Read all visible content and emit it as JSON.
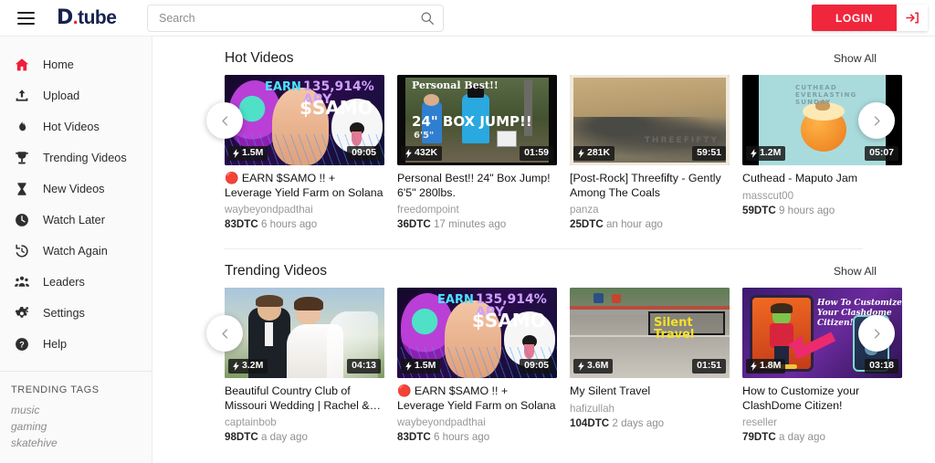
{
  "brand": {
    "logo_d": "D",
    "logo_dot": ".",
    "logo_rest": "tube"
  },
  "search": {
    "placeholder": "Search",
    "value": "",
    "icon": "search-icon"
  },
  "auth": {
    "login_label": "LOGIN",
    "signin_icon": "sign-in-icon"
  },
  "colors": {
    "accent_red": "#f0263c",
    "brand_navy": "#17224d",
    "sidebar_bg": "#fafafa"
  },
  "sidebar": {
    "items": [
      {
        "label": "Home",
        "icon": "home-icon",
        "active": true
      },
      {
        "label": "Upload",
        "icon": "upload-icon",
        "active": false
      },
      {
        "label": "Hot Videos",
        "icon": "flame-icon",
        "active": false
      },
      {
        "label": "Trending Videos",
        "icon": "trophy-icon",
        "active": false
      },
      {
        "label": "New Videos",
        "icon": "hourglass-icon",
        "active": false
      },
      {
        "label": "Watch Later",
        "icon": "clock-icon",
        "active": false
      },
      {
        "label": "Watch Again",
        "icon": "history-icon",
        "active": false
      },
      {
        "label": "Leaders",
        "icon": "people-icon",
        "active": false
      },
      {
        "label": "Settings",
        "icon": "gear-icon",
        "active": false
      },
      {
        "label": "Help",
        "icon": "help-icon",
        "active": false
      }
    ],
    "tags_title": "TRENDING TAGS",
    "tags": [
      "music",
      "gaming",
      "skatehive"
    ]
  },
  "sections": [
    {
      "title": "Hot Videos",
      "show_all": "Show All",
      "videos": [
        {
          "title": "🔴 EARN $SAMO !! + Leverage Yield Farm on Solana TULIP…",
          "author": "waybeyondpadthai",
          "dtc": "83DTC",
          "age": "6 hours ago",
          "views": "1.5M",
          "duration": "09:05",
          "art": "samo"
        },
        {
          "title": "Personal Best!! 24\" Box Jump! 6'5\" 280lbs.",
          "author": "freedompoint",
          "dtc": "36DTC",
          "age": "17 minutes ago",
          "views": "432K",
          "duration": "01:59",
          "art": "boxjump"
        },
        {
          "title": "[Post-Rock] Threefifty - Gently Among The Coals",
          "author": "panza",
          "dtc": "25DTC",
          "age": "an hour ago",
          "views": "281K",
          "duration": "59:51",
          "art": "postrock"
        },
        {
          "title": "Cuthead - Maputo Jam",
          "author": "masscut00",
          "dtc": "59DTC",
          "age": "9 hours ago",
          "views": "1.2M",
          "duration": "05:07",
          "art": "cuthead"
        }
      ]
    },
    {
      "title": "Trending Videos",
      "show_all": "Show All",
      "videos": [
        {
          "title": "Beautiful Country Club of Missouri Wedding | Rachel &…",
          "author": "captainbob",
          "dtc": "98DTC",
          "age": "a day ago",
          "views": "3.2M",
          "duration": "04:13",
          "art": "wedding"
        },
        {
          "title": "🔴 EARN $SAMO !! + Leverage Yield Farm on Solana TULIP…",
          "author": "waybeyondpadthai",
          "dtc": "83DTC",
          "age": "6 hours ago",
          "views": "1.5M",
          "duration": "09:05",
          "art": "samo"
        },
        {
          "title": "My Silent Travel",
          "author": "hafizullah",
          "dtc": "104DTC",
          "age": "2 days ago",
          "views": "3.6M",
          "duration": "01:51",
          "art": "silent"
        },
        {
          "title": "How to Customize your ClashDome Citizen! Blockchain…",
          "author": "reseller",
          "dtc": "79DTC",
          "age": "a day ago",
          "views": "1.8M",
          "duration": "03:18",
          "art": "clash"
        }
      ]
    }
  ],
  "carousel": {
    "prev_icon": "chevron-left-icon",
    "next_icon": "chevron-right-icon"
  }
}
